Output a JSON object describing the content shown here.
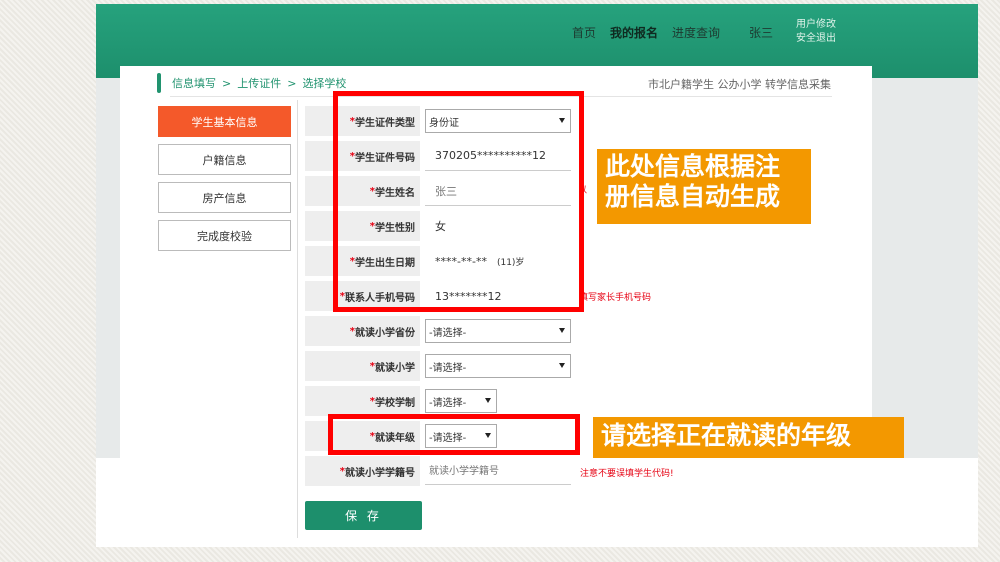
{
  "header": {
    "nav": [
      "首页",
      "我的报名",
      "进度查询",
      "张三"
    ],
    "user_links": [
      "用户修改",
      "安全退出"
    ]
  },
  "breadcrumb": {
    "items": [
      "信息填写",
      "上传证件",
      "选择学校"
    ],
    "separator": ">",
    "page_title": "市北户籍学生 公办小学 转学信息采集"
  },
  "sidebar": {
    "items": [
      "学生基本信息",
      "户籍信息",
      "房产信息",
      "完成度校验"
    ],
    "active_index": 0
  },
  "form": {
    "required_mark": "*",
    "id_type": {
      "label": "学生证件类型",
      "value": "身份证"
    },
    "id_number": {
      "label": "学生证件号码",
      "value": "370205**********12"
    },
    "name": {
      "label": "学生姓名",
      "value": "张三"
    },
    "gender": {
      "label": "学生性别",
      "value": "女"
    },
    "birth": {
      "label": "学生出生日期",
      "value": "****-**-**",
      "age": "(11)岁"
    },
    "contact_phone": {
      "label": "联系人手机号码",
      "value": "13*******12",
      "hint": "填写家长手机号码"
    },
    "province": {
      "label": "就读小学省份",
      "value": "-请选择-"
    },
    "school": {
      "label": "就读小学",
      "value": "-请选择-"
    },
    "school_system": {
      "label": "学校学制",
      "value": "-请选择-"
    },
    "grade": {
      "label": "就读年级",
      "value": "-请选择-"
    },
    "school_roll": {
      "label": "就读小学学籍号",
      "placeholder": "就读小学学籍号",
      "hint": "注意不要误填学生代码!"
    },
    "name_hint_fragment": "以"
  },
  "save_label": "保 存",
  "annotations": {
    "callout1_line1": "此处信息根据注",
    "callout1_line2": "册信息自动生成",
    "callout2": "请选择正在就读的年级"
  },
  "colors": {
    "header_green": "#1d8f6c",
    "accent_orange": "#f4592a",
    "callout_orange": "#f39800",
    "highlight_red": "#ff0000",
    "required_red": "#e60012"
  }
}
